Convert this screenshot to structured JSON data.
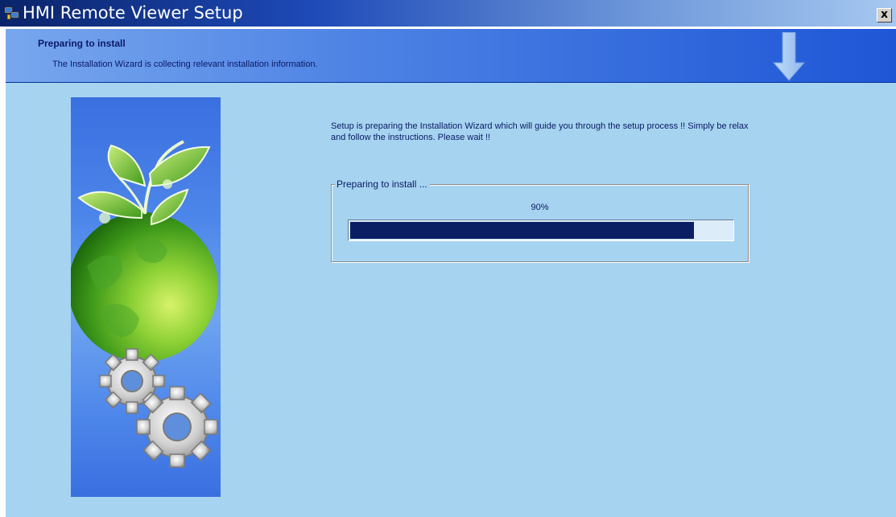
{
  "window": {
    "title": "HMI Remote Viewer Setup",
    "close_label": "x"
  },
  "header": {
    "title": "Preparing to install",
    "subtitle": "The Installation Wizard is collecting relevant installation information."
  },
  "main": {
    "description": "Setup is preparing the Installation Wizard which will guide you through the setup process !! Simply be relax and follow the instructions. Please wait !!",
    "group_label": "Preparing to install ...",
    "progress_text": "90%",
    "progress_value": 0.9
  },
  "icons": {
    "app": "setup-app-icon",
    "header_arrow": "down-arrow-icon",
    "side_image": "globe-sprout-gears-image"
  },
  "colors": {
    "titlebar_start": "#0a246a",
    "body_background": "#a6d3ef",
    "progress_fill": "#0a1f63",
    "text": "#0a1a66"
  }
}
